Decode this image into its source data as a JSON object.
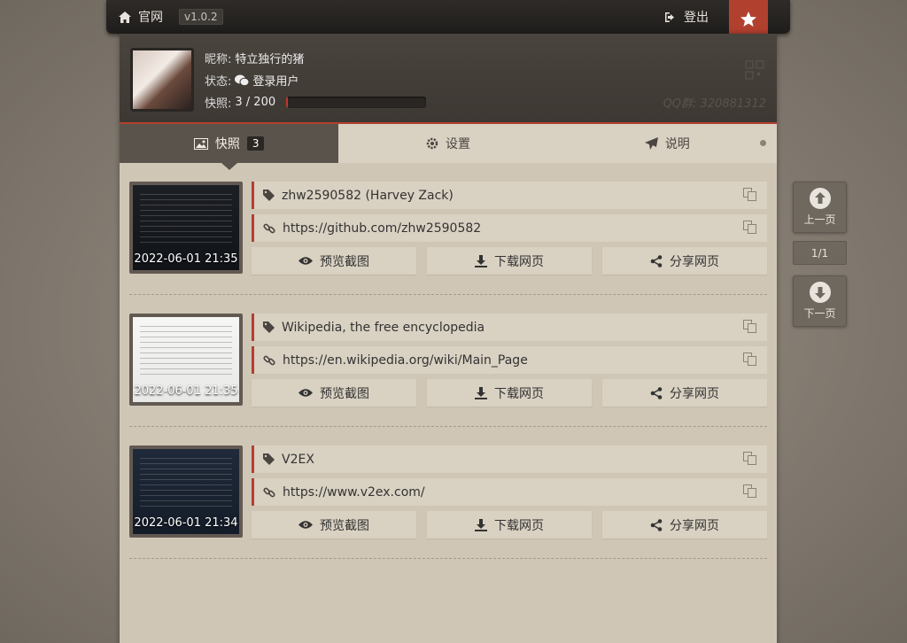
{
  "topbar": {
    "home_label": "官网",
    "version": "v1.0.2",
    "logout_label": "登出"
  },
  "profile": {
    "nickname_label": "昵称:",
    "nickname": "特立独行的猪",
    "status_label": "状态:",
    "status": "登录用户",
    "snapshot_label": "快照:",
    "snapshot_count": "3 / 200",
    "snapshot_progress": 0.015,
    "qq": "QQ群: 320881312"
  },
  "tabs": [
    {
      "label": "快照",
      "badge": "3"
    },
    {
      "label": "设置"
    },
    {
      "label": "说明"
    }
  ],
  "items": [
    {
      "title": "zhw2590582 (Harvey Zack)",
      "url": "https://github.com/zhw2590582",
      "time": "2022-06-01 21:35"
    },
    {
      "title": "Wikipedia, the free encyclopedia",
      "url": "https://en.wikipedia.org/wiki/Main_Page",
      "time": "2022-06-01 21:35"
    },
    {
      "title": "V2EX",
      "url": "https://www.v2ex.com/",
      "time": "2022-06-01 21:34"
    }
  ],
  "actions": {
    "preview": "预览截图",
    "download": "下载网页",
    "share": "分享网页"
  },
  "pager": {
    "prev": "上一页",
    "page": "1/1",
    "next": "下一页"
  },
  "colors": {
    "accent": "#b2402f",
    "panel": "#cfc6b6",
    "dark": "#2a2623"
  }
}
